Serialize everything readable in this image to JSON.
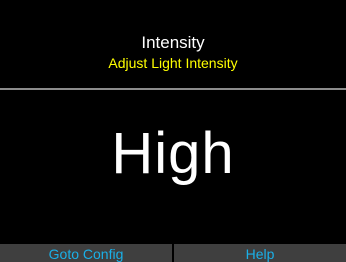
{
  "header": {
    "title": "Intensity",
    "subtitle": "Adjust Light Intensity"
  },
  "main": {
    "value": "High"
  },
  "footer": {
    "left_label": "Goto Config",
    "right_label": "Help"
  },
  "colors": {
    "background": "#000000",
    "title": "#ffffff",
    "subtitle": "#ffff00",
    "divider": "#8c8c8c",
    "softkey_bar": "#3f3f3f",
    "softkey_text": "#1ab0e8"
  }
}
